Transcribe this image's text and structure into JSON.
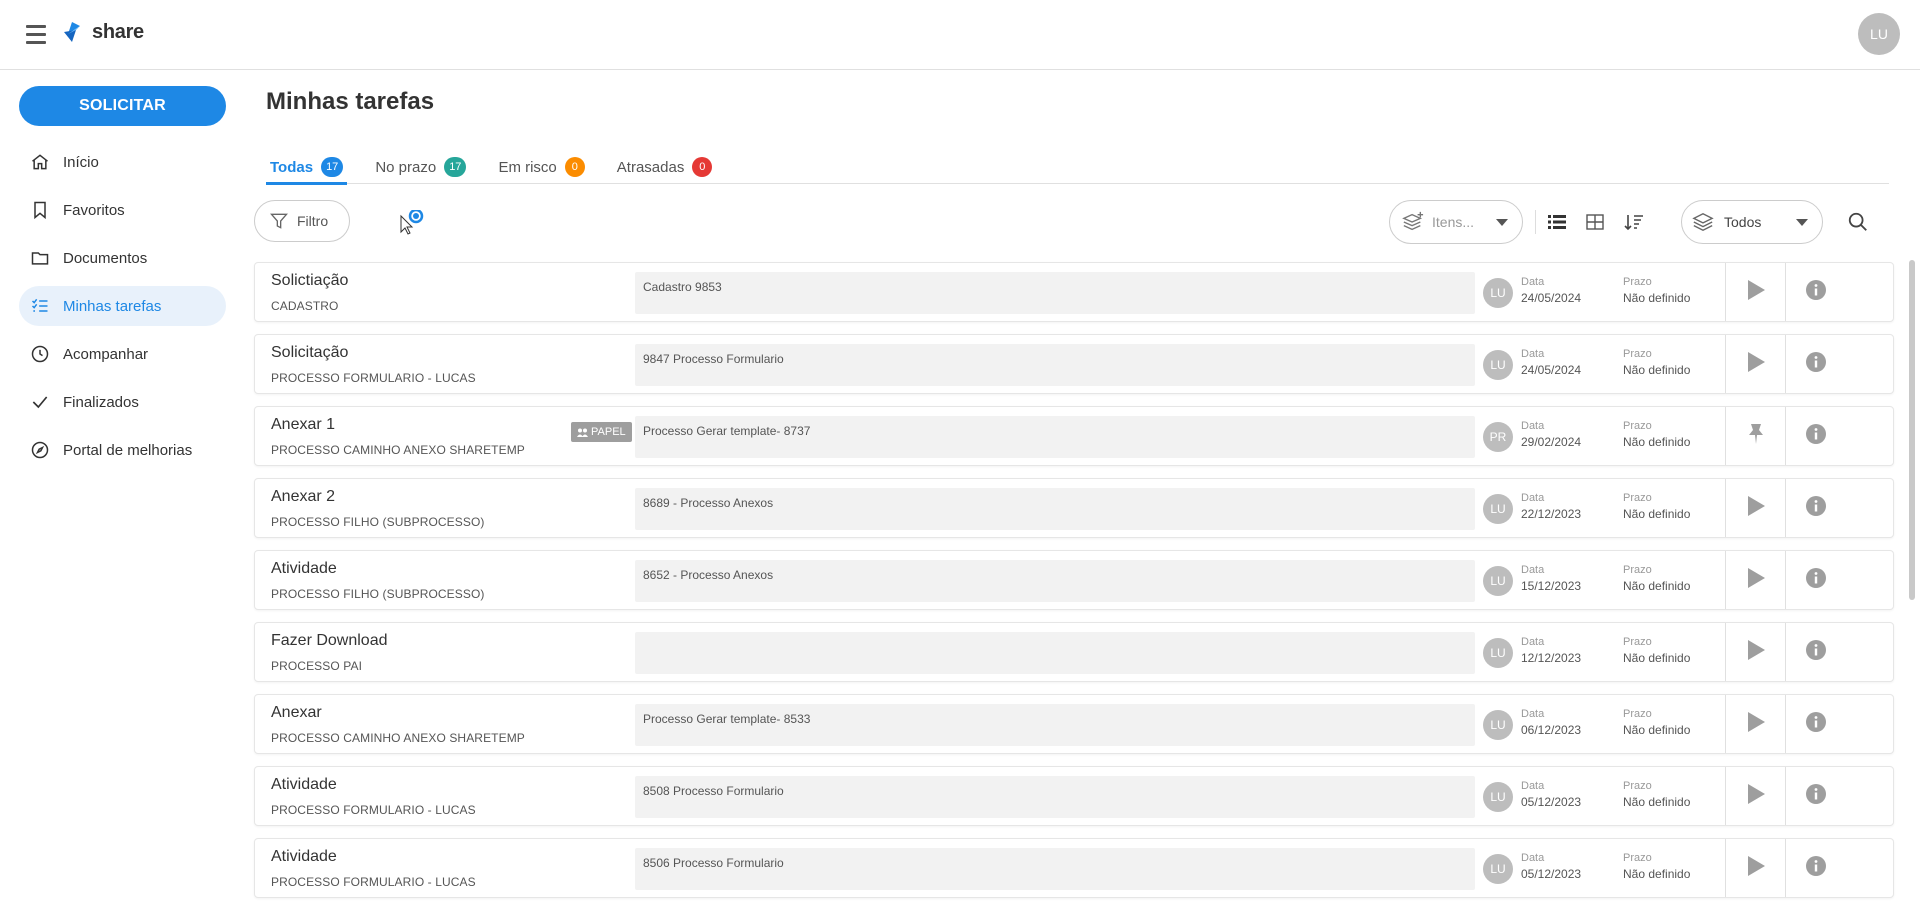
{
  "app": {
    "logo_text": "share",
    "user_initials": "LU"
  },
  "sidebar": {
    "solicitar_label": "SOLICITAR",
    "items": [
      {
        "label": "Início",
        "icon": "home-icon"
      },
      {
        "label": "Favoritos",
        "icon": "bookmark-icon"
      },
      {
        "label": "Documentos",
        "icon": "folder-icon"
      },
      {
        "label": "Minhas tarefas",
        "icon": "task-list-icon",
        "active": true
      },
      {
        "label": "Acompanhar",
        "icon": "clock-icon"
      },
      {
        "label": "Finalizados",
        "icon": "check-icon"
      },
      {
        "label": "Portal de melhorias",
        "icon": "compass-icon"
      }
    ]
  },
  "main": {
    "title": "Minhas tarefas",
    "tabs": [
      {
        "label": "Todas",
        "count": "17",
        "color": "#1e88e5"
      },
      {
        "label": "No prazo",
        "count": "17",
        "color": "#26a69a"
      },
      {
        "label": "Em risco",
        "count": "0",
        "color": "#fb8c00"
      },
      {
        "label": "Atrasadas",
        "count": "0",
        "color": "#e53935"
      }
    ]
  },
  "toolbar": {
    "filter_label": "Filtro",
    "itens_placeholder": "Itens...",
    "todos_label": "Todos"
  },
  "tasks": [
    {
      "title": "Solictiação",
      "subtitle": "CADASTRO",
      "description": "Cadastro 9853",
      "avatar": "LU",
      "date_label": "Data",
      "date": "24/05/2024",
      "deadline_label": "Prazo",
      "deadline": "Não definido",
      "action": "play-icon"
    },
    {
      "title": "Solicitação",
      "subtitle": "PROCESSO FORMULARIO - LUCAS",
      "description": "9847 Processo Formulario",
      "avatar": "LU",
      "date_label": "Data",
      "date": "24/05/2024",
      "deadline_label": "Prazo",
      "deadline": "Não definido",
      "action": "play-icon"
    },
    {
      "title": "Anexar 1",
      "subtitle": "PROCESSO CAMINHO ANEXO SHARETEMP",
      "description": "Processo Gerar template- 8737",
      "avatar": "PR",
      "date_label": "Data",
      "date": "29/02/2024",
      "deadline_label": "Prazo",
      "deadline": "Não definido",
      "action": "pin-icon",
      "tag": "PAPEL"
    },
    {
      "title": "Anexar 2",
      "subtitle": "PROCESSO FILHO (SUBPROCESSO)",
      "description": "8689 - Processo Anexos",
      "avatar": "LU",
      "date_label": "Data",
      "date": "22/12/2023",
      "deadline_label": "Prazo",
      "deadline": "Não definido",
      "action": "play-icon"
    },
    {
      "title": "Atividade",
      "subtitle": "PROCESSO FILHO (SUBPROCESSO)",
      "description": "8652 - Processo Anexos",
      "avatar": "LU",
      "date_label": "Data",
      "date": "15/12/2023",
      "deadline_label": "Prazo",
      "deadline": "Não definido",
      "action": "play-icon"
    },
    {
      "title": "Fazer Download",
      "subtitle": "PROCESSO PAI",
      "description": "",
      "avatar": "LU",
      "date_label": "Data",
      "date": "12/12/2023",
      "deadline_label": "Prazo",
      "deadline": "Não definido",
      "action": "play-icon"
    },
    {
      "title": "Anexar",
      "subtitle": "PROCESSO CAMINHO ANEXO SHARETEMP",
      "description": "Processo Gerar template- 8533",
      "avatar": "LU",
      "date_label": "Data",
      "date": "06/12/2023",
      "deadline_label": "Prazo",
      "deadline": "Não definido",
      "action": "play-icon"
    },
    {
      "title": "Atividade",
      "subtitle": "PROCESSO FORMULARIO - LUCAS",
      "description": "8508 Processo Formulario",
      "avatar": "LU",
      "date_label": "Data",
      "date": "05/12/2023",
      "deadline_label": "Prazo",
      "deadline": "Não definido",
      "action": "play-icon"
    },
    {
      "title": "Atividade",
      "subtitle": "PROCESSO FORMULARIO - LUCAS",
      "description": "8506 Processo Formulario",
      "avatar": "LU",
      "date_label": "Data",
      "date": "05/12/2023",
      "deadline_label": "Prazo",
      "deadline": "Não definido",
      "action": "play-icon"
    }
  ],
  "colors": {
    "accent": "#1e88e5",
    "active_nav_bg": "#e8f1fb"
  }
}
